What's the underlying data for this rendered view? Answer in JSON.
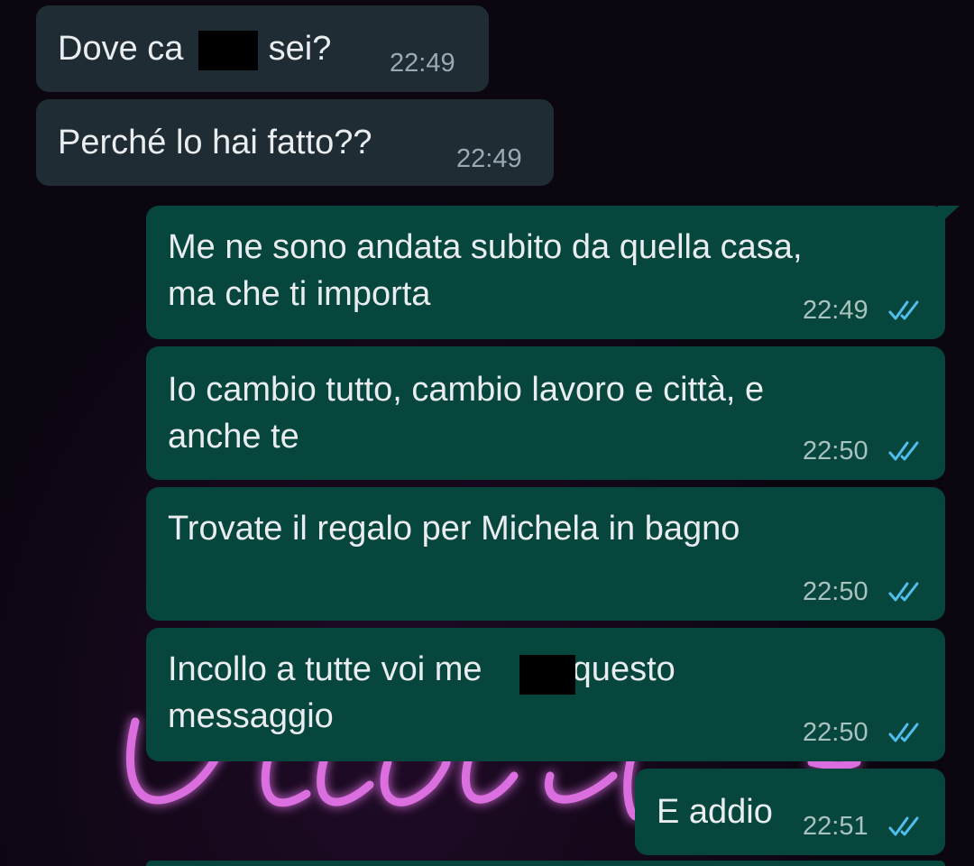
{
  "messages": [
    {
      "direction": "incoming",
      "text": "Dove ca            sei?",
      "time": "22:49",
      "redacted": true
    },
    {
      "direction": "incoming",
      "text": "Perché lo hai fatto??",
      "time": "22:49"
    },
    {
      "direction": "outgoing",
      "text": "Me ne sono andata subito da quella casa,\nma che ti importa",
      "time": "22:49",
      "status": "read"
    },
    {
      "direction": "outgoing",
      "text": "Io cambio tutto, cambio lavoro e città, e\nanche te",
      "time": "22:50",
      "status": "read"
    },
    {
      "direction": "outgoing",
      "text": "Trovate il regalo per Michela in bagno",
      "time": "22:50",
      "status": "read"
    },
    {
      "direction": "outgoing",
      "text": "Incollo a tutte voi me         e questo\nmessaggio",
      "time": "22:50",
      "status": "read",
      "redacted": true
    },
    {
      "direction": "outgoing",
      "text": "E addio",
      "time": "22:51",
      "status": "read"
    }
  ],
  "colors": {
    "incoming_bubble": "#1f2c34",
    "outgoing_bubble": "#06463d",
    "read_ticks": "#53bdeb",
    "neon": "#e85ef0"
  },
  "icons": [
    "double-check-icon"
  ]
}
